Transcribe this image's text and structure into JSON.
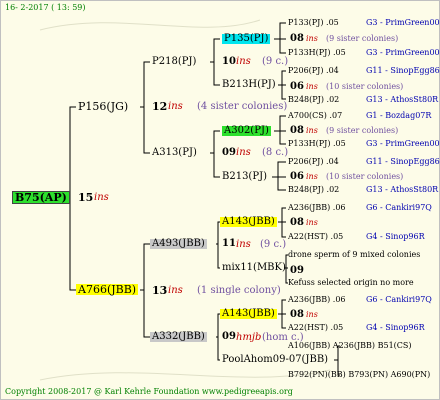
{
  "date": "16- 2-2017 ( 13: 59)",
  "footer": "Copyright 2008-2017 @ Karl Kehrle Foundation   www.pedigreeapis.org",
  "root": {
    "id": "B75(AP)",
    "num": "15",
    "tag": "ins"
  },
  "g1": [
    {
      "id": "P156(JG)",
      "num": "12",
      "tag": "ins",
      "note": "(4 sister colonies)"
    },
    {
      "id": "A766(JBB)",
      "num": "13",
      "tag": "ins",
      "note": "(1 single colony)"
    }
  ],
  "g2": [
    {
      "id": "P218(PJ)"
    },
    {
      "id": "A313(PJ)"
    },
    {
      "id": "A493(JBB)",
      "num": "11",
      "tag": "ins",
      "note": "(9 c.)"
    },
    {
      "id": "A332(JBB)",
      "num": "09",
      "tag": "hmjb",
      "note": "(hom c.)"
    }
  ],
  "g3": [
    {
      "id": "P135(PJ)",
      "num": "10",
      "tag": "ins",
      "note": "(9 c.)"
    },
    {
      "id": "B213H(PJ)"
    },
    {
      "id": "A302(PJ)",
      "num": "09",
      "tag": "ins",
      "note": "(8 c.)"
    },
    {
      "id": "B213(PJ)"
    },
    {
      "id": "A143(JBB)",
      "num": "08",
      "tag": "ins"
    },
    {
      "id": "mix11(MBK)"
    },
    {
      "id": "A143(JBB)",
      "num": "08",
      "tag": "ins"
    },
    {
      "id": "PoolAhom09-07(JBB)"
    }
  ],
  "g4": [
    {
      "a": "P133(PJ) .05",
      "b": "G3 - PrimGreen00"
    },
    {
      "num": "08",
      "tag": "ins",
      "note": "(9 sister colonies)"
    },
    {
      "a": "P133H(PJ) .05",
      "b": "G3 - PrimGreen00"
    },
    {
      "a": "P206(PJ) .04",
      "b": "G11 - SinopEgg86R"
    },
    {
      "num": "06",
      "tag": "ins",
      "note": "(10 sister colonies)"
    },
    {
      "a": "B248(PJ) .02",
      "b": "G13 - AthosSt80R"
    },
    {
      "a": "A700(CS) .07",
      "b": "G1 - Bozdag07R"
    },
    {
      "num": "08",
      "tag": "ins",
      "note": "(9 sister colonies)"
    },
    {
      "a": "P133H(PJ) .05",
      "b": "G3 - PrimGreen00"
    },
    {
      "a": "P206(PJ) .04",
      "b": "G11 - SinopEgg86R"
    },
    {
      "num": "06",
      "tag": "ins",
      "note": "(10 sister colonies)"
    },
    {
      "a": "B248(PJ) .02",
      "b": "G13 - AthosSt80R"
    },
    {
      "a": "A236(JBB) .06",
      "b": "G6 - Cankiri97Q"
    },
    {
      "num": "08",
      "tag": "ins",
      "note": ""
    },
    {
      "a": "A22(HST) .05",
      "b": "G4 - Sinop96R"
    },
    {
      "a": "drone sperm of 9 mixed colonies",
      "b": ""
    },
    {
      "num": "09",
      "tag": "",
      "note": ""
    },
    {
      "a": "Kefuss selected origin no more",
      "b": ""
    },
    {
      "a": "A236(JBB) .06",
      "b": "G6 - Cankiri97Q"
    },
    {
      "num": "08",
      "tag": "ins",
      "note": ""
    },
    {
      "a": "A22(HST) .05",
      "b": "G4 - Sinop96R"
    },
    {
      "a": "A106(JBB) A236(JBB) B51(CS)",
      "b": ""
    },
    {
      "num": "",
      "tag": "",
      "note": ""
    },
    {
      "a": "B792(PN)(BB) B793(PN) A690(PN)",
      "b": ""
    }
  ]
}
